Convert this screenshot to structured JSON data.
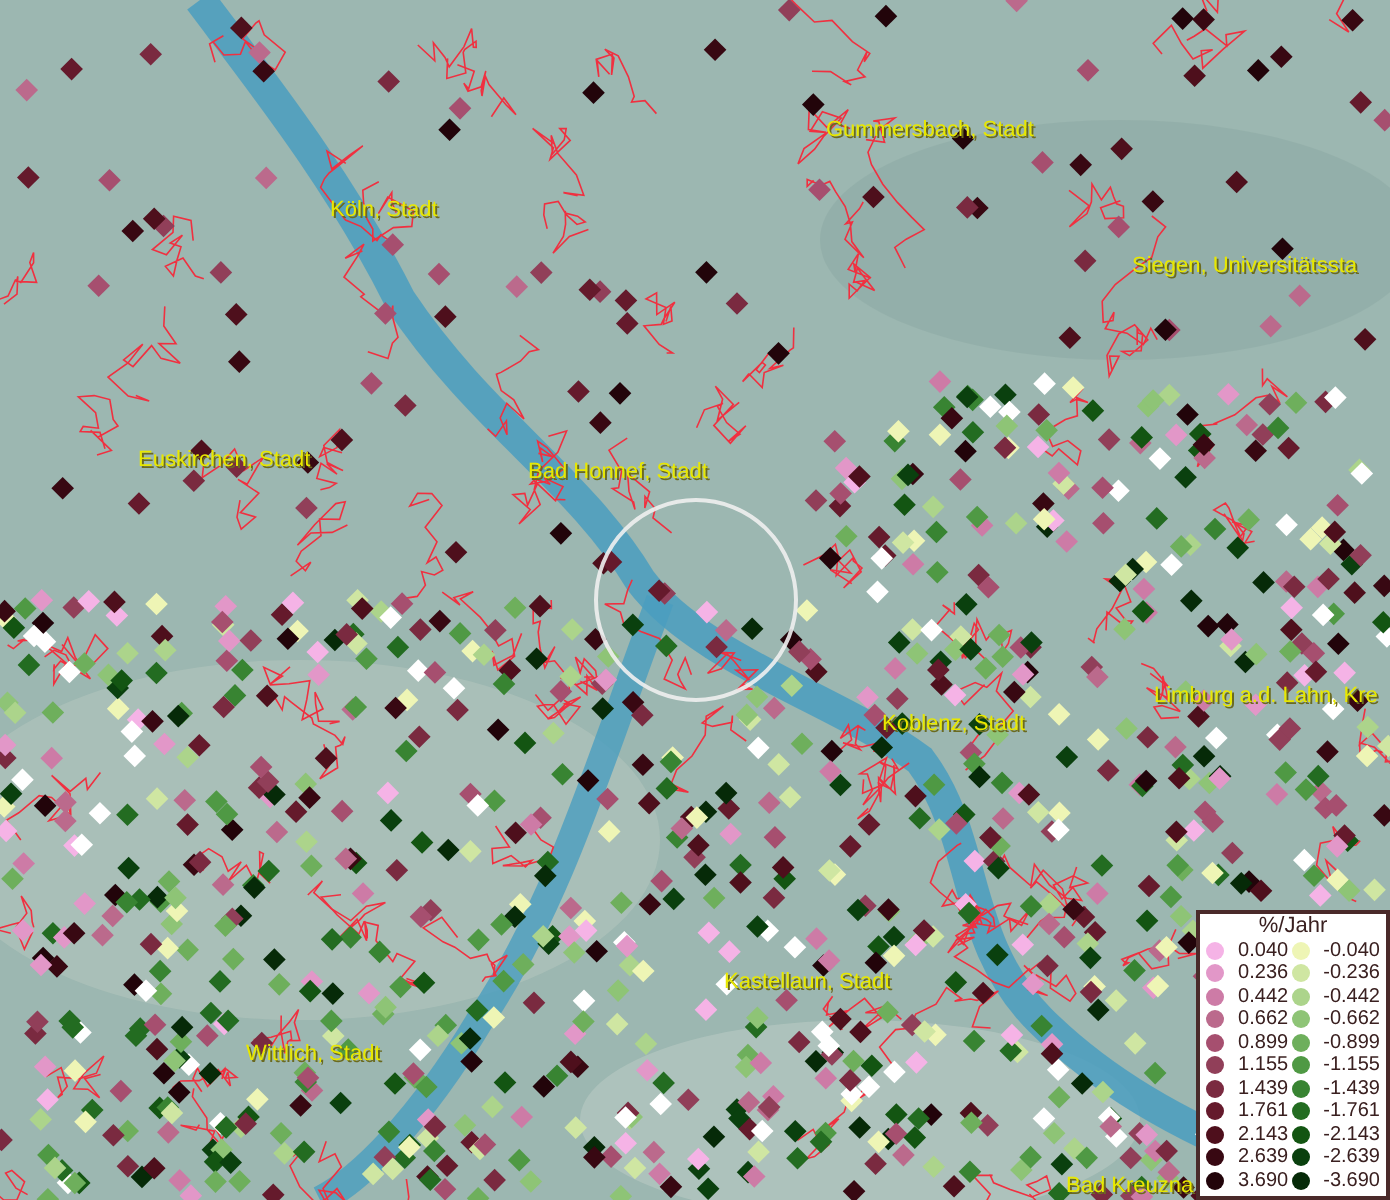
{
  "map": {
    "places": [
      {
        "name": "Gummersbach, Stadt"
      },
      {
        "name": "Köln, Stadt"
      },
      {
        "name": "Siegen, Universitätssta"
      },
      {
        "name": "Euskirchen, Stadt"
      },
      {
        "name": "Bad Honnef, Stadt"
      },
      {
        "name": "Limburg a.d. Lahn, Kre"
      },
      {
        "name": "Koblenz, Stadt"
      },
      {
        "name": "Kastellaun, Stadt"
      },
      {
        "name": "Wittlich, Stadt"
      },
      {
        "name": "Bad Kreuzna"
      }
    ]
  },
  "legend": {
    "title": "%/Jahr",
    "rows": [
      {
        "pos": {
          "value": "0.040",
          "color": "#f5b3e6"
        },
        "neg": {
          "value": "-0.040",
          "color": "#eef5b5"
        }
      },
      {
        "pos": {
          "value": "0.236",
          "color": "#e297c8"
        },
        "neg": {
          "value": "-0.236",
          "color": "#cfe6a2"
        }
      },
      {
        "pos": {
          "value": "0.442",
          "color": "#cd7ba6"
        },
        "neg": {
          "value": "-0.442",
          "color": "#acd48b"
        }
      },
      {
        "pos": {
          "value": "0.662",
          "color": "#bb6a8c"
        },
        "neg": {
          "value": "-0.662",
          "color": "#8ec476"
        }
      },
      {
        "pos": {
          "value": "0.899",
          "color": "#a64f6f"
        },
        "neg": {
          "value": "-0.899",
          "color": "#6eaf5c"
        }
      },
      {
        "pos": {
          "value": "1.155",
          "color": "#913f59"
        },
        "neg": {
          "value": "-1.155",
          "color": "#4f9944"
        }
      },
      {
        "pos": {
          "value": "1.439",
          "color": "#7a2a40"
        },
        "neg": {
          "value": "-1.439",
          "color": "#388432"
        }
      },
      {
        "pos": {
          "value": "1.761",
          "color": "#651a2c"
        },
        "neg": {
          "value": "-1.761",
          "color": "#236c21"
        }
      },
      {
        "pos": {
          "value": "2.143",
          "color": "#4e0f1c"
        },
        "neg": {
          "value": "-2.143",
          "color": "#135512"
        }
      },
      {
        "pos": {
          "value": "2.639",
          "color": "#380812"
        },
        "neg": {
          "value": "-2.639",
          "color": "#0a400e"
        }
      },
      {
        "pos": {
          "value": "3.690",
          "color": "#22040a"
        },
        "neg": {
          "value": "-3.690",
          "color": "#062a08"
        }
      }
    ]
  }
}
